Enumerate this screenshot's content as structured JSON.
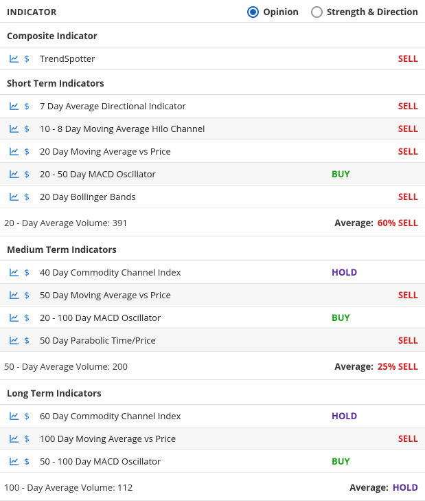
{
  "header": {
    "title": "INDICATOR",
    "view_options": {
      "opinion": "Opinion",
      "strength": "Strength & Direction",
      "selected": "opinion"
    }
  },
  "sections": [
    {
      "name": "Composite Indicator",
      "rows": [
        {
          "label": "TrendSpotter",
          "signal": "SELL",
          "signal_class": "sell",
          "col": "b"
        }
      ]
    },
    {
      "name": "Short Term Indicators",
      "rows": [
        {
          "label": "7 Day Average Directional Indicator",
          "signal": "SELL",
          "signal_class": "sell",
          "col": "b"
        },
        {
          "label": "10 - 8 Day Moving Average Hilo Channel",
          "signal": "SELL",
          "signal_class": "sell",
          "col": "b"
        },
        {
          "label": "20 Day Moving Average vs Price",
          "signal": "SELL",
          "signal_class": "sell",
          "col": "b"
        },
        {
          "label": "20 - 50 Day MACD Oscillator",
          "signal": "BUY",
          "signal_class": "buy",
          "col": "a"
        },
        {
          "label": "20 Day Bollinger Bands",
          "signal": "SELL",
          "signal_class": "sell",
          "col": "b"
        }
      ],
      "summary": {
        "volume_text": "20 - Day Average Volume: 391",
        "avg_label": "Average:",
        "avg_value": "60% SELL",
        "avg_class": "sell"
      }
    },
    {
      "name": "Medium Term Indicators",
      "rows": [
        {
          "label": "40 Day Commodity Channel Index",
          "signal": "HOLD",
          "signal_class": "hold",
          "col": "a"
        },
        {
          "label": "50 Day Moving Average vs Price",
          "signal": "SELL",
          "signal_class": "sell",
          "col": "b"
        },
        {
          "label": "20 - 100 Day MACD Oscillator",
          "signal": "BUY",
          "signal_class": "buy",
          "col": "a"
        },
        {
          "label": "50 Day Parabolic Time/Price",
          "signal": "SELL",
          "signal_class": "sell",
          "col": "b"
        }
      ],
      "summary": {
        "volume_text": "50 - Day Average Volume: 200",
        "avg_label": "Average:",
        "avg_value": "25% SELL",
        "avg_class": "sell"
      }
    },
    {
      "name": "Long Term Indicators",
      "rows": [
        {
          "label": "60 Day Commodity Channel Index",
          "signal": "HOLD",
          "signal_class": "hold",
          "col": "a"
        },
        {
          "label": "100 Day Moving Average vs Price",
          "signal": "SELL",
          "signal_class": "sell",
          "col": "b"
        },
        {
          "label": "50 - 100 Day MACD Oscillator",
          "signal": "BUY",
          "signal_class": "buy",
          "col": "a"
        }
      ],
      "summary": {
        "volume_text": "100 - Day Average Volume: 112",
        "avg_label": "Average:",
        "avg_value": "HOLD",
        "avg_class": "hold"
      }
    }
  ]
}
